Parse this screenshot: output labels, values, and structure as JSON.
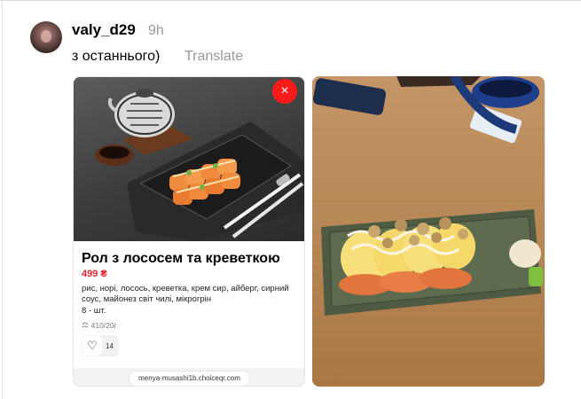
{
  "post": {
    "username": "valy_d29",
    "time": "9h",
    "text": "з останнього)",
    "translate_label": "Translate"
  },
  "menu_card": {
    "close_icon": "×",
    "title": "Рол з лососем та креветкою",
    "price": "499 ₴",
    "ingredients": "рис, норі, лосось, креветка, крем сир, айберг, сирний соус, майонез світ чилі, мікрогрін",
    "quantity": "8 - шт.",
    "weight": "410/20г",
    "like_count": "14",
    "url": "menya-musashi1b.choiceqr.com"
  },
  "icons": {
    "heart": "heart-icon",
    "scale": "scale-icon",
    "close": "close-icon"
  },
  "colors": {
    "price_red": "#e2262f",
    "close_red": "#ff1a1a",
    "muted_gray": "#999999"
  }
}
